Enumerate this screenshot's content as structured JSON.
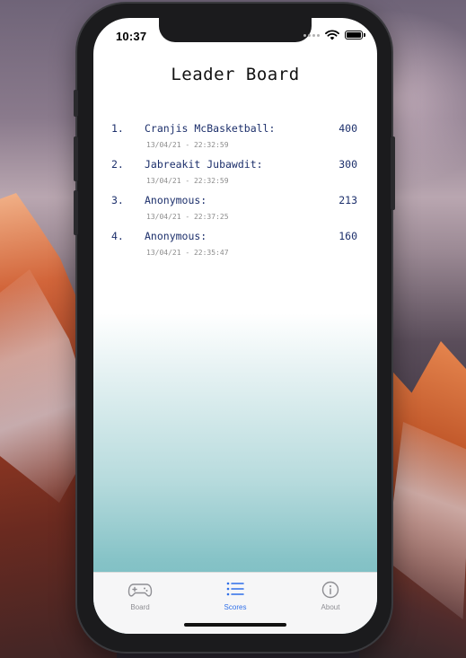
{
  "status_bar": {
    "time": "10:37"
  },
  "screen": {
    "title": "Leader Board"
  },
  "scores": [
    {
      "rank": "1.",
      "name": "Cranjis McBasketball:",
      "score": "400",
      "timestamp": "13/04/21 - 22:32:59"
    },
    {
      "rank": "2.",
      "name": "Jabreakit Jubawdit:",
      "score": "300",
      "timestamp": "13/04/21 - 22:32:59"
    },
    {
      "rank": "3.",
      "name": "Anonymous:",
      "score": "213",
      "timestamp": "13/04/21 - 22:37:25"
    },
    {
      "rank": "4.",
      "name": "Anonymous:",
      "score": "160",
      "timestamp": "13/04/21 - 22:35:47"
    }
  ],
  "tab_bar": {
    "tabs": [
      {
        "label": "Board",
        "icon": "gamepad-icon",
        "selected": false
      },
      {
        "label": "Scores",
        "icon": "list-icon",
        "selected": true
      },
      {
        "label": "About",
        "icon": "info-icon",
        "selected": false
      }
    ]
  },
  "colors": {
    "accent": "#2f6fe8",
    "inactive": "#8e8e93",
    "score_text": "#1c2f6b",
    "timestamp_text": "#8c8c8c",
    "gradient_bottom": "#6eb6bb"
  }
}
